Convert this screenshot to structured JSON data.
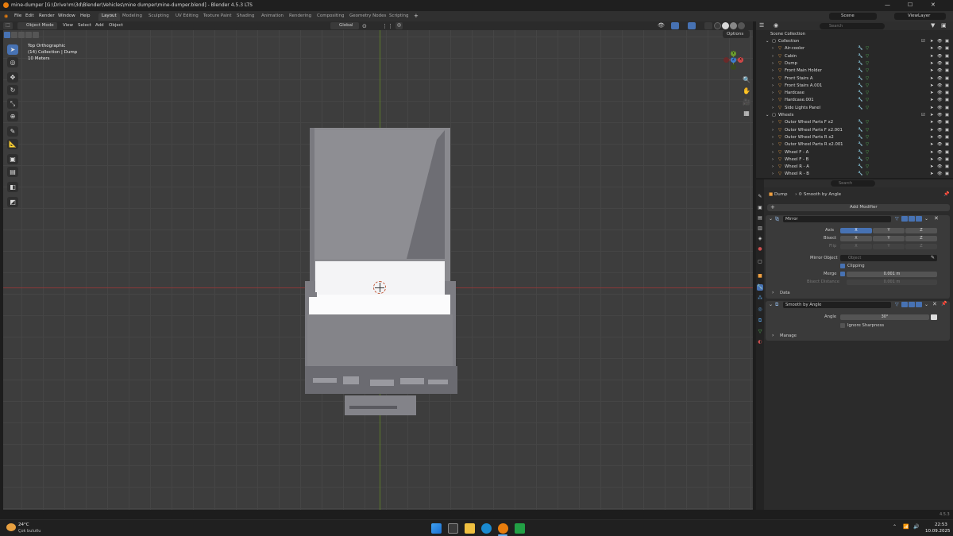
{
  "window": {
    "title": "mine-dumper [G:\\Drive'ım\\3d\\Blender\\Vehicles\\mine dumper\\mine-dumper.blend] - Blender 4.5.3 LTS",
    "controls": [
      "—",
      "☐",
      "✕"
    ]
  },
  "menu": {
    "items": [
      "File",
      "Edit",
      "Render",
      "Window",
      "Help"
    ],
    "workspaces": [
      "Layout",
      "Modeling",
      "Sculpting",
      "UV Editing",
      "Texture Paint",
      "Shading",
      "Animation",
      "Rendering",
      "Compositing",
      "Geometry Nodes",
      "Scripting"
    ],
    "active_workspace": "Layout",
    "add_tab": "+",
    "scene": "Scene",
    "view_layer": "ViewLayer"
  },
  "viewport_header": {
    "mode": "Object Mode",
    "menus": [
      "View",
      "Select",
      "Add",
      "Object"
    ],
    "orientation": "Global",
    "options": "Options"
  },
  "viewport": {
    "info": [
      "Top Orthographic",
      "(14) Collection | Dump",
      "10 Meters"
    ],
    "gizmo": {
      "x": "X",
      "y": "Y",
      "z": "Z"
    }
  },
  "outliner": {
    "search_placeholder": "Search",
    "root": "Scene Collection",
    "items": [
      {
        "label": "Collection",
        "type": "collection"
      },
      {
        "label": "Air-cooler",
        "type": "object"
      },
      {
        "label": "Cabin",
        "type": "object"
      },
      {
        "label": "Dump",
        "type": "object"
      },
      {
        "label": "Front Main Holder",
        "type": "object"
      },
      {
        "label": "Front Stairs A",
        "type": "object"
      },
      {
        "label": "Front Stairs A.001",
        "type": "object"
      },
      {
        "label": "Hardcase",
        "type": "object"
      },
      {
        "label": "Hardcase.001",
        "type": "object"
      },
      {
        "label": "Side Lights Panel",
        "type": "object"
      },
      {
        "label": "Wheels",
        "type": "collection"
      },
      {
        "label": "Outer Wheel Parts F x2",
        "type": "object"
      },
      {
        "label": "Outer Wheel Parts F x2.001",
        "type": "object"
      },
      {
        "label": "Outer Wheel Parts R x2",
        "type": "object"
      },
      {
        "label": "Outer Wheel Parts R x2.001",
        "type": "object"
      },
      {
        "label": "Wheel F - A",
        "type": "object"
      },
      {
        "label": "Wheel F - B",
        "type": "object"
      },
      {
        "label": "Wheel R - A",
        "type": "object"
      },
      {
        "label": "Wheel R - B",
        "type": "object"
      }
    ]
  },
  "properties": {
    "search_placeholder": "Search",
    "breadcrumb_object": "Dump",
    "breadcrumb_modifier": "Smooth by Angle",
    "add_modifier": "Add Modifier",
    "mirror": {
      "name": "Mirror",
      "axis_label": "Axis",
      "bisect_label": "Bisect",
      "flip_label": "Flip",
      "x": "X",
      "y": "Y",
      "z": "Z",
      "mirror_object_label": "Mirror Object",
      "mirror_object_placeholder": "Object",
      "clipping": "Clipping",
      "merge_label": "Merge",
      "merge_value": "0.001 m",
      "bisect_distance_label": "Bisect Distance",
      "bisect_distance_value": "0.001 m",
      "data": "Data"
    },
    "smooth": {
      "name": "Smooth by Angle",
      "angle_label": "Angle",
      "angle_value": "30°",
      "ignore_sharpness": "Ignore Sharpness",
      "manage": "Manage"
    }
  },
  "statusbar": {
    "version": "4.5.3"
  },
  "taskbar": {
    "weather_temp": "24°C",
    "weather_text": "Çok bulutlu",
    "time": "22:53",
    "date": "10.09.2025"
  }
}
